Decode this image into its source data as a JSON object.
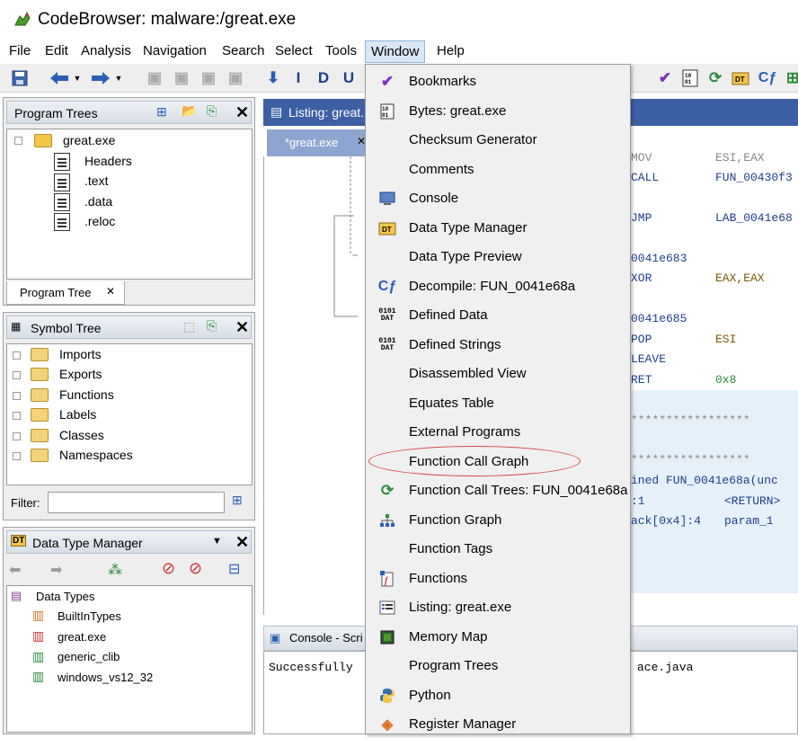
{
  "window": {
    "title": "CodeBrowser: malware:/great.exe"
  },
  "menubar": [
    "File",
    "Edit",
    "Analysis",
    "Navigation",
    "Search",
    "Select",
    "Tools",
    "Window",
    "Help"
  ],
  "program_trees": {
    "title": "Program Trees",
    "root": "great.exe",
    "children": [
      "Headers",
      ".text",
      ".data",
      ".reloc"
    ],
    "tab_label": "Program Tree"
  },
  "symbol_tree": {
    "title": "Symbol Tree",
    "items": [
      "Imports",
      "Exports",
      "Functions",
      "Labels",
      "Classes",
      "Namespaces"
    ],
    "filter_label": "Filter:"
  },
  "data_type_manager": {
    "title": "Data Type Manager",
    "root": "Data Types",
    "items": [
      "BuiltInTypes",
      "great.exe",
      "generic_clib",
      "windows_vs12_32"
    ]
  },
  "listing": {
    "header_title": "Listing: great.",
    "tab_label": "*great.exe",
    "lines": [
      {
        "col1": "MOV",
        "col2": "ESI,EAX"
      },
      {
        "col1": "CALL",
        "col2": "FUN_00430f3"
      },
      {
        "col1": "JMP",
        "col2": "LAB_0041e68"
      },
      {
        "col1": "0041e683",
        "col2": ""
      },
      {
        "col1": "XOR",
        "col2": "EAX,EAX"
      },
      {
        "col1": "0041e685",
        "col2": ""
      },
      {
        "col1": "POP",
        "col2": "ESI"
      },
      {
        "col1": "LEAVE",
        "col2": ""
      },
      {
        "col1": "RET",
        "col2": "0x8"
      },
      {
        "col1": "*****************",
        "col2": ""
      },
      {
        "col1": "*****************",
        "col2": ""
      },
      {
        "col1": "ined FUN_0041e68a(unc",
        "col2": ""
      },
      {
        "col1": ":1",
        "col2": "<RETURN>"
      },
      {
        "col1": "ack[0x4]:4",
        "col2": "param_1"
      }
    ]
  },
  "console": {
    "title": "Console - Scri",
    "text_left": "Successfully",
    "text_right": "ace.java"
  },
  "window_menu": {
    "items": [
      {
        "label": "Bookmarks",
        "icon": "checkmark-icon"
      },
      {
        "label": "Bytes: great.exe",
        "icon": "bytes-icon"
      },
      {
        "label": "Checksum Generator",
        "icon": ""
      },
      {
        "label": "Comments",
        "icon": ""
      },
      {
        "label": "Console",
        "icon": "console-icon"
      },
      {
        "label": "Data Type Manager",
        "icon": "dt-icon"
      },
      {
        "label": "Data Type Preview",
        "icon": ""
      },
      {
        "label": "Decompile: FUN_0041e68a",
        "icon": "decompile-icon"
      },
      {
        "label": "Defined Data",
        "icon": "dat-icon"
      },
      {
        "label": "Defined Strings",
        "icon": "dat-icon"
      },
      {
        "label": "Disassembled View",
        "icon": ""
      },
      {
        "label": "Equates Table",
        "icon": ""
      },
      {
        "label": "External Programs",
        "icon": ""
      },
      {
        "label": "Function Call Graph",
        "icon": ""
      },
      {
        "label": "Function Call Trees: FUN_0041e68a",
        "icon": "call-trees-icon"
      },
      {
        "label": "Function Graph",
        "icon": "graph-icon"
      },
      {
        "label": "Function Tags",
        "icon": ""
      },
      {
        "label": "Functions",
        "icon": "functions-icon"
      },
      {
        "label": "Listing: great.exe",
        "icon": "listing-icon"
      },
      {
        "label": "Memory Map",
        "icon": "memory-icon"
      },
      {
        "label": "Program Trees",
        "icon": ""
      },
      {
        "label": "Python",
        "icon": "python-icon"
      },
      {
        "label": "Register Manager",
        "icon": "register-icon"
      }
    ]
  },
  "toolbar_letters": [
    "I",
    "D",
    "U"
  ],
  "colors": {
    "accent": "#3d5fa3",
    "highlight_ring": "#d94545",
    "menu_bg": "#f0f0f0"
  }
}
